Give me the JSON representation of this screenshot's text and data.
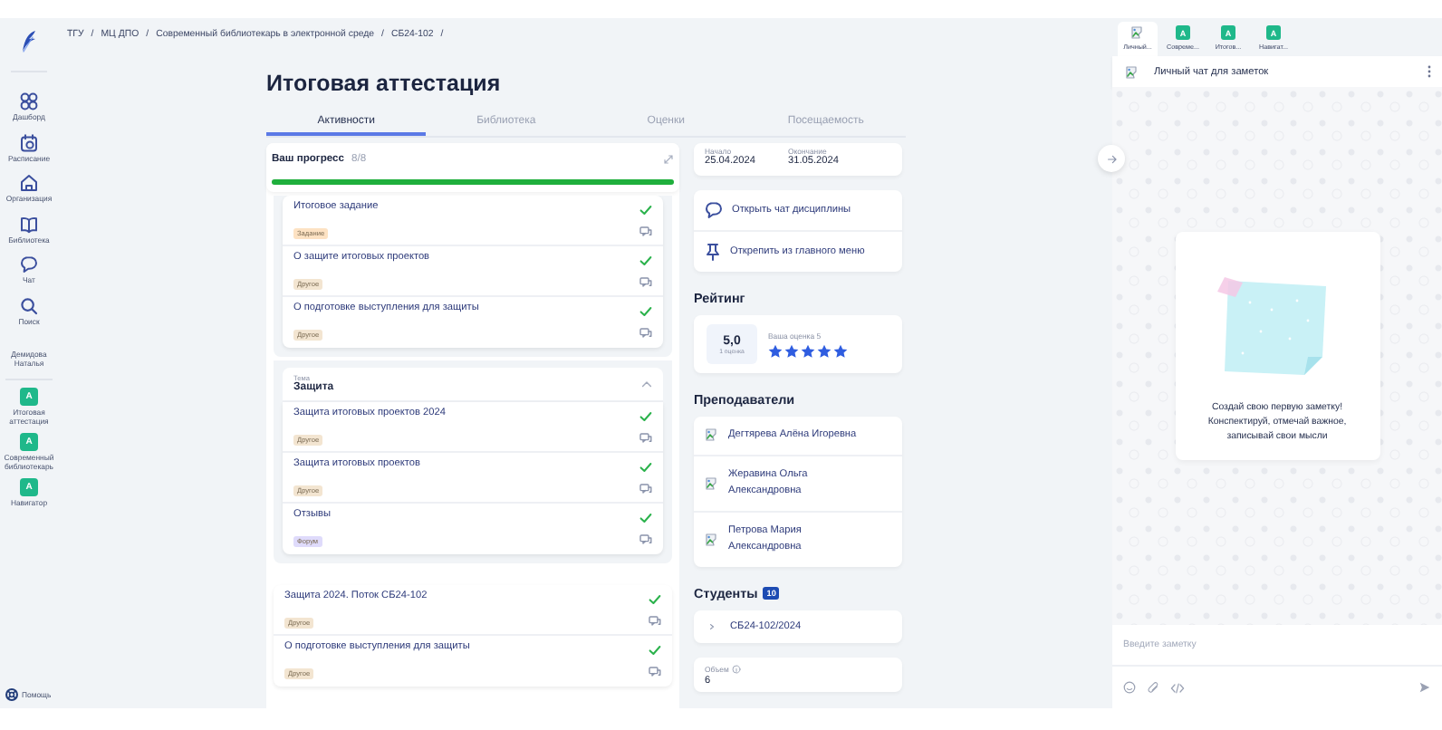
{
  "breadcrumb": {
    "separator": "/",
    "items": [
      "ТГУ",
      "МЦ ДПО",
      "Современный библиотекарь в электронной среде",
      "СБ24-102"
    ]
  },
  "sidebar": {
    "nav": [
      {
        "label": "Дашборд",
        "kind": "dashboard"
      },
      {
        "label": "Расписание",
        "kind": "calendar"
      },
      {
        "label": "Организация",
        "kind": "home"
      },
      {
        "label": "Библиотека",
        "kind": "book"
      },
      {
        "label": "Чат",
        "kind": "chat"
      },
      {
        "label": "Поиск",
        "kind": "search"
      }
    ],
    "user": "Демидова Наталья",
    "courses": [
      {
        "badge": "A",
        "label": "Итоговая аттестация"
      },
      {
        "badge": "A",
        "label": "Современный библиотекарь"
      },
      {
        "badge": "A",
        "label": "Навигатор"
      }
    ],
    "help": "Помощь"
  },
  "page": {
    "title": "Итоговая аттестация",
    "tabs": [
      {
        "label": "Активности",
        "selected": true
      },
      {
        "label": "Библиотека",
        "selected": false
      },
      {
        "label": "Оценки",
        "selected": false
      },
      {
        "label": "Посещаемость",
        "selected": false
      }
    ],
    "progress": {
      "label": "Ваш прогресс",
      "count": "8/8",
      "level": 1
    },
    "activity_groups": [
      {
        "nested": true,
        "items": [
          {
            "title": "Итоговое задание",
            "tag": "Задание",
            "color": "#fde2c3",
            "done": true
          },
          {
            "title": "О защите итоговых проектов",
            "tag": "Другое",
            "color": "#f3e5d1",
            "done": true
          },
          {
            "title": "О подготовке выступления для защиты",
            "tag": "Другое",
            "color": "#f3e5d1",
            "done": true
          }
        ]
      },
      {
        "nested": true,
        "caption": "Тема",
        "title": "Защита",
        "expanded": true,
        "items": [
          {
            "title": "Защита итоговых проектов 2024",
            "tag": "Другое",
            "color": "#f3e5d1",
            "done": true
          },
          {
            "title": "Защита итоговых проектов",
            "tag": "Другое",
            "color": "#f3e5d1",
            "done": true
          },
          {
            "title": "Отзывы",
            "tag": "Форум",
            "color": "#dfdbfb",
            "done": true
          }
        ]
      },
      {
        "nested": false,
        "items": [
          {
            "title": "Защита 2024. Поток СБ24-102",
            "tag": "Другое",
            "color": "#f3e5d1",
            "done": true
          },
          {
            "title": "О подготовке выступления для защиты",
            "tag": "Другое",
            "color": "#f3e5d1",
            "done": true
          }
        ]
      }
    ]
  },
  "details": {
    "period": {
      "start_label": "Начало",
      "start": "25.04.2024",
      "end_label": "Окончание",
      "end": "31.05.2024"
    },
    "actions": [
      {
        "label": "Открыть чат дисциплины",
        "kind": "chat"
      },
      {
        "label": "Открепить из главного меню",
        "kind": "pin"
      }
    ],
    "rating": {
      "title": "Рейтинг",
      "score": "5,0",
      "count": "1 оценка",
      "yours": "Ваша оценка 5",
      "stars": 5
    },
    "teachers": {
      "title": "Преподаватели",
      "items": [
        "Дегтярева Алёна Игоревна",
        "Жеравина Ольга Александровна",
        "Петрова Мария Александровна"
      ]
    },
    "students": {
      "title": "Студенты",
      "count": "10",
      "groups": [
        {
          "label": "СБ24-102/2024",
          "expanded": false
        }
      ]
    },
    "volume": {
      "label": "Объем",
      "value": "6"
    }
  },
  "chat": {
    "tabs": [
      {
        "label": "Личный...",
        "kind": "image",
        "selected": true
      },
      {
        "label": "Совреме...",
        "kind": "course",
        "badge": "A",
        "selected": false
      },
      {
        "label": "Итогов...",
        "kind": "course",
        "badge": "A",
        "selected": false
      },
      {
        "label": "Навигат...",
        "kind": "course",
        "badge": "A",
        "selected": false
      }
    ],
    "title": "Личный чат для заметок",
    "empty_text": "Создай свою первую заметку! Конспектируй, отмечай важное, записывай свои мысли",
    "placeholder": "Введите заметку"
  }
}
